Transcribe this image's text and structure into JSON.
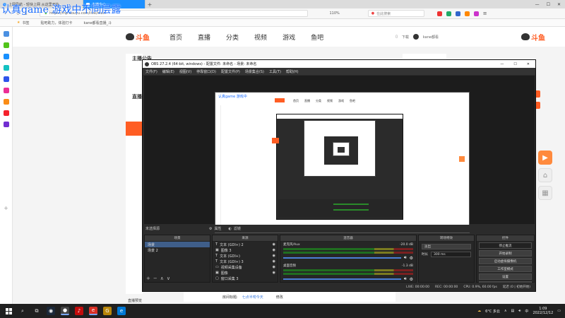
{
  "overlay_caption": "认真game 游戏中不同层露",
  "browser": {
    "tabs": [
      {
        "label": "上网导航 - 轻快上网 从这里开始",
        "active": false
      },
      {
        "label": "主播中心",
        "active": true
      }
    ],
    "new_tab": "+",
    "url": "https://mp.douyu.com/live/main",
    "zoom": "110%",
    "search_placeholder": "在此搜索",
    "bookmarks_label": "书签",
    "bookmark_items": [
      "贴吧助力，体验打卡",
      "kane都看直播_斗"
    ]
  },
  "site": {
    "logo": "斗鱼",
    "logo_sub": "DOUYU.COM",
    "nav": [
      "首页",
      "直播",
      "分类",
      "视频",
      "游戏",
      "鱼吧"
    ],
    "download": "下载",
    "username": "kane都看",
    "left_panel_title": "主播公告",
    "left_panel_sub": "直播设置",
    "bottom_left": "直播预览",
    "bottom_line_label": "房间标题:",
    "bottom_line_value": "七点半唠今天",
    "bottom_line_action": "修改"
  },
  "obs": {
    "title": "OBS 27.2.4 (64-bit, windows) - 配置文件: 未命名 - 场景: 未命名",
    "menu": [
      "文件(F)",
      "编辑(E)",
      "视图(V)",
      "停靠窗口(D)",
      "配置文件(P)",
      "场景集合(S)",
      "工具(T)",
      "帮助(H)"
    ],
    "source_label": "未选择源",
    "prop_btn": "属性",
    "filter_btn": "滤镜",
    "docks": {
      "scenes": "场景",
      "sources": "来源",
      "mixer": "混音器",
      "transitions": "转场特效",
      "controls": "控件"
    },
    "scenes": [
      {
        "label": "场景",
        "selected": true
      },
      {
        "label": "场景 2",
        "selected": false
      }
    ],
    "sources": [
      "文本 (GDI+) 2",
      "图像 3",
      "文本 (GDI+)",
      "文本 (GDI+) 3",
      "视频采集设备",
      "图像",
      "窗口采集 3"
    ],
    "mixer": [
      {
        "name": "麦克风/Aux",
        "db": "-20.0 dB"
      },
      {
        "name": "桌面音频",
        "db": "-1.3 dB"
      }
    ],
    "transition": {
      "type": "淡出",
      "duration_label": "时长",
      "duration": "300 ms"
    },
    "controls": [
      "停止推流",
      "开始录制",
      "启动虚拟摄像机",
      "工作室模式",
      "设置",
      "退出"
    ],
    "status": [
      "LIVE: 00:00:00",
      "REC: 00:00:00",
      "CPU: 0.9%, 60.00 fps",
      "延迟 (0 | 初始开始)"
    ]
  },
  "right_tools": [
    "直播",
    "主页",
    "扫码"
  ],
  "taskbar": {
    "weather": "6°C 多云",
    "time": "1:09",
    "date": "2022/12/12",
    "input_method": "中"
  },
  "colors": {
    "brand": "#ff5d23",
    "obs_bg": "#2b2b2b",
    "taskbar": "#202020",
    "tab_active": "#1e90ff"
  }
}
